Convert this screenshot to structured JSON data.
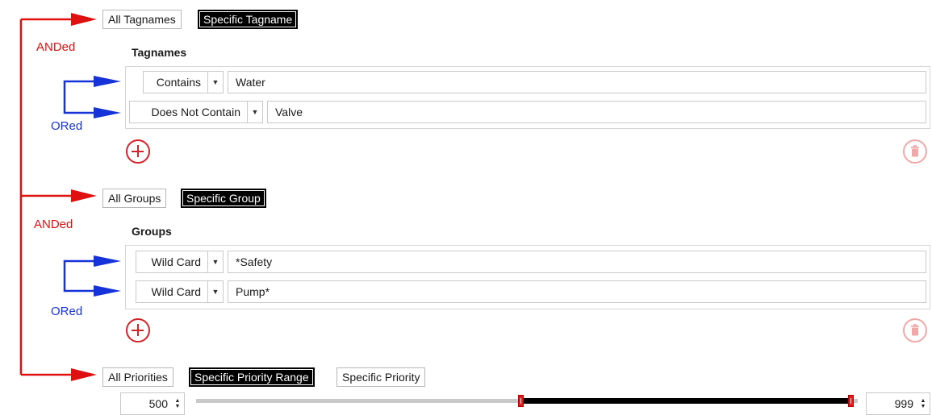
{
  "tagname_filter": {
    "toggles": [
      "All Tagnames",
      "Specific Tagname"
    ],
    "selected": "Specific Tagname",
    "title": "Tagnames",
    "rows": [
      {
        "operator": "Contains",
        "value": "Water"
      },
      {
        "operator": "Does Not Contain",
        "value": "Valve"
      }
    ]
  },
  "group_filter": {
    "toggles": [
      "All Groups",
      "Specific Group"
    ],
    "selected": "Specific Group",
    "title": "Groups",
    "rows": [
      {
        "operator": "Wild Card",
        "value": "*Safety"
      },
      {
        "operator": "Wild Card",
        "value": "Pump*"
      }
    ]
  },
  "priority_filter": {
    "toggles": [
      "All Priorities",
      "Specific Priority Range",
      "Specific Priority"
    ],
    "selected": "Specific Priority Range",
    "range_min": "500",
    "range_max": "999"
  },
  "annotations": {
    "and_label": "ANDed",
    "or_label": "ORed"
  },
  "icons": {
    "add": "plus-circle-icon",
    "delete": "trash-icon",
    "dropdown": "caret-down-icon",
    "spinner": "up-down-arrows-icon"
  },
  "colors": {
    "annotation_and": "#e01010",
    "annotation_or": "#1533d8",
    "add_button": "#d2232a",
    "delete_button_disabled": "#f0a8a8",
    "toggle_selected_bg": "#000000",
    "range_thumb": "#e31b1b"
  }
}
